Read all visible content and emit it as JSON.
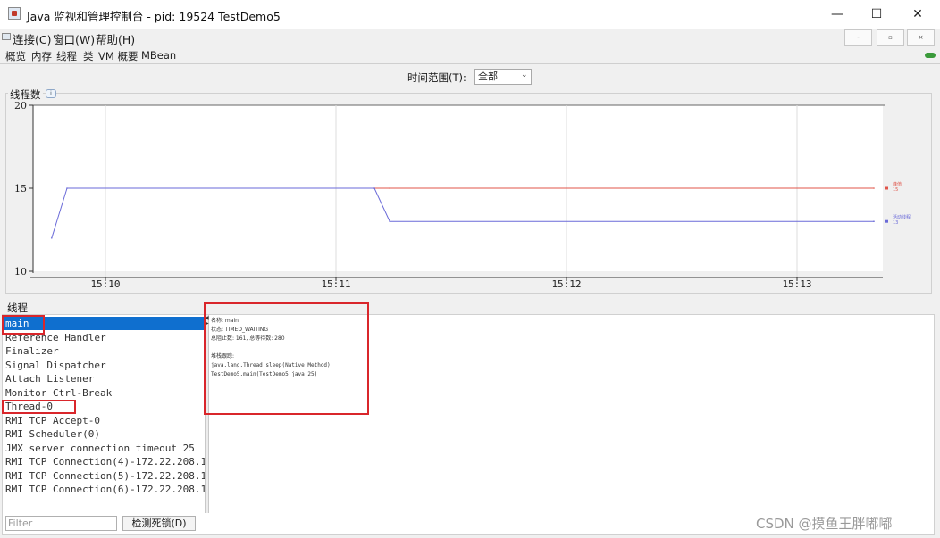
{
  "window": {
    "title": "Java 监视和管理控制台 - pid: 19524 TestDemo5",
    "controls": {
      "minimize": "—",
      "maximize": "☐",
      "close": "✕"
    },
    "app_icon": "java-app-icon"
  },
  "menubar": {
    "items": [
      "连接(C)",
      "窗口(W)",
      "帮助(H)"
    ],
    "mdi_buttons": [
      "-",
      "▫",
      "×"
    ]
  },
  "tabs": [
    "概览",
    "内存",
    "线程",
    "类",
    "VM 概要",
    "MBean"
  ],
  "active_tab": "线程",
  "time_range": {
    "label": "时间范围(T):",
    "value": "全部"
  },
  "chart": {
    "title": "线程数",
    "info_badge": "i"
  },
  "chart_data": {
    "type": "line",
    "x": [
      "15:09:46",
      "15:09:50",
      "15:11:10",
      "15:11:14",
      "15:13:20"
    ],
    "xticks": [
      "15:10",
      "15:11",
      "15:12",
      "15:13"
    ],
    "ylim": [
      10,
      20
    ],
    "yticks": [
      "20",
      "15",
      "10"
    ],
    "grid": true,
    "series": [
      {
        "name": "峰值",
        "label_value": "15",
        "color": "#e0554a",
        "values": [
          null,
          null,
          15,
          15,
          15
        ]
      },
      {
        "name": "活动线程",
        "label_value": "13",
        "color": "#6a6ad8",
        "values": [
          12,
          15,
          15,
          13,
          13
        ]
      }
    ]
  },
  "threads_panel": {
    "title": "线程",
    "threads": [
      "main",
      "Reference Handler",
      "Finalizer",
      "Signal Dispatcher",
      "Attach Listener",
      "Monitor Ctrl-Break",
      "Thread-0",
      "RMI TCP Accept-0",
      "RMI Scheduler(0)",
      "JMX server connection timeout 25",
      "RMI TCP Connection(4)-172.22.208.1",
      "RMI TCP Connection(5)-172.22.208.1",
      "RMI TCP Connection(6)-172.22.208.1"
    ],
    "selected_index": 0,
    "details": {
      "name_line": "名称: main",
      "state_line": "状态: TIMED_WAITING",
      "counts_line": "总阻止数: 161, 总等待数: 280",
      "stack_title": "堆栈跟踪:",
      "stack": [
        "java.lang.Thread.sleep(Native Method)",
        "TestDemo5.main(TestDemo5.java:25)"
      ]
    },
    "filter_placeholder": "Filter",
    "detect_deadlock_label": "检测死锁(D)"
  },
  "colors": {
    "highlight": "#d9262b",
    "selection": "#0f6fcf"
  },
  "watermark": "CSDN @摸鱼王胖嘟嘟"
}
